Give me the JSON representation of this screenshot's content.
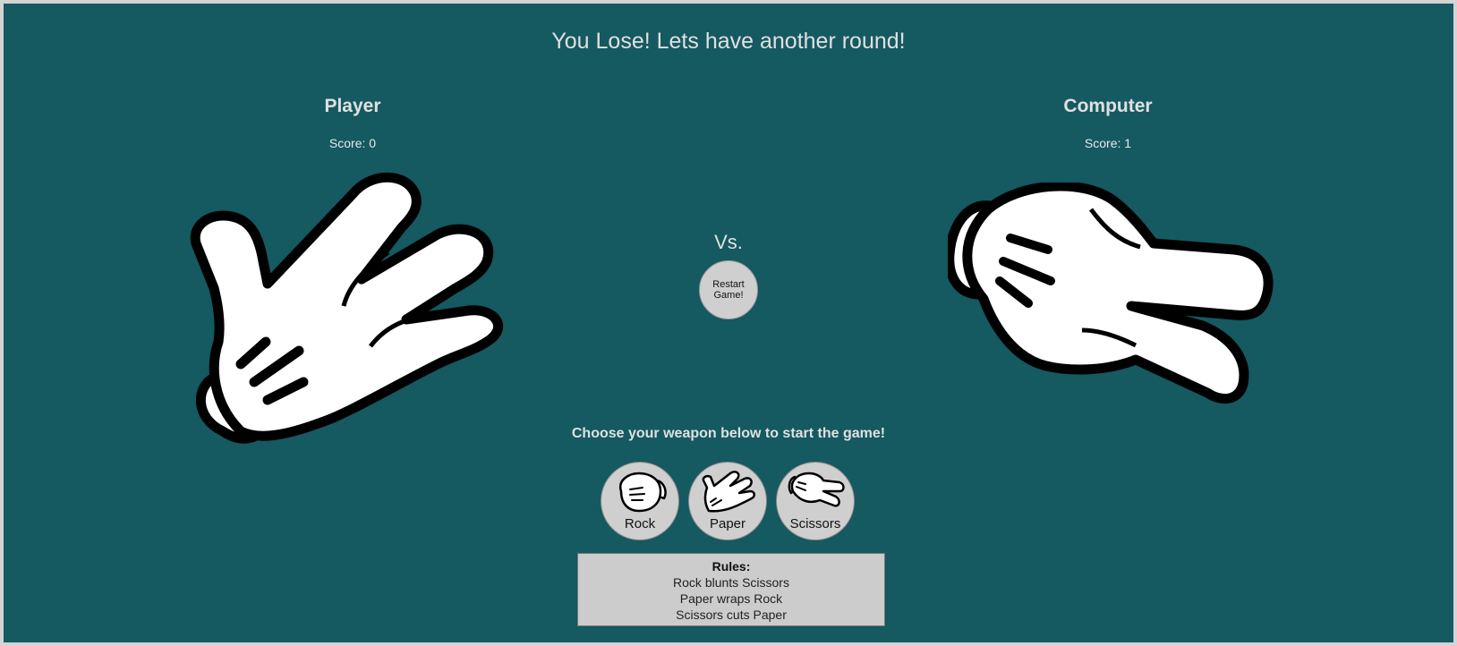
{
  "result_message": "You Lose! Lets have another round!",
  "player": {
    "name": "Player",
    "score": "Score: 0",
    "hand": "paper-hand-icon"
  },
  "computer": {
    "name": "Computer",
    "score": "Score: 1",
    "hand": "scissors-hand-icon"
  },
  "vs_label": "Vs.",
  "restart_label": "Restart Game!",
  "prompt": "Choose your weapon below to start the game!",
  "weapons": [
    {
      "label": "Rock",
      "icon": "rock-hand-icon"
    },
    {
      "label": "Paper",
      "icon": "paper-hand-icon"
    },
    {
      "label": "Scissors",
      "icon": "scissors-hand-icon"
    }
  ],
  "rules": {
    "title": "Rules:",
    "lines": [
      "Rock blunts Scissors",
      "Paper wraps Rock",
      "Scissors cuts Paper"
    ]
  },
  "colors": {
    "background": "#155961",
    "text": "#e0e0e0",
    "button": "#cfcfcf"
  }
}
